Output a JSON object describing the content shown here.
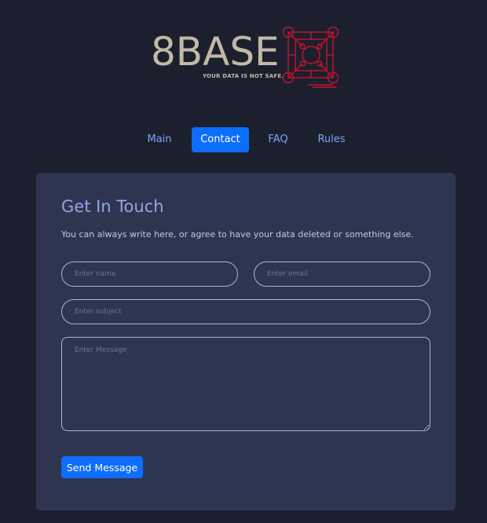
{
  "logo": {
    "name": "8BASE",
    "tagline": "YOUR DATA IS NOT SAFE.",
    "icon": "network-square-icon",
    "text_color": "#c2b9a7",
    "mark_color": "#c5152b"
  },
  "nav": {
    "items": [
      {
        "label": "Main",
        "active": false
      },
      {
        "label": "Contact",
        "active": true
      },
      {
        "label": "FAQ",
        "active": false
      },
      {
        "label": "Rules",
        "active": false
      }
    ]
  },
  "contact": {
    "title": "Get In Touch",
    "description": "You can always write here, or agree to have your data deleted or something else.",
    "name_placeholder": "Enter name",
    "email_placeholder": "Enter email",
    "subject_placeholder": "Enter subject",
    "message_placeholder": "Enter Message",
    "send_label": "Send Message"
  },
  "colors": {
    "background": "#1c1f2e",
    "card": "#2d3550",
    "accent": "#0d6efd",
    "link": "#7ba7ff",
    "title": "#93a5e2"
  }
}
